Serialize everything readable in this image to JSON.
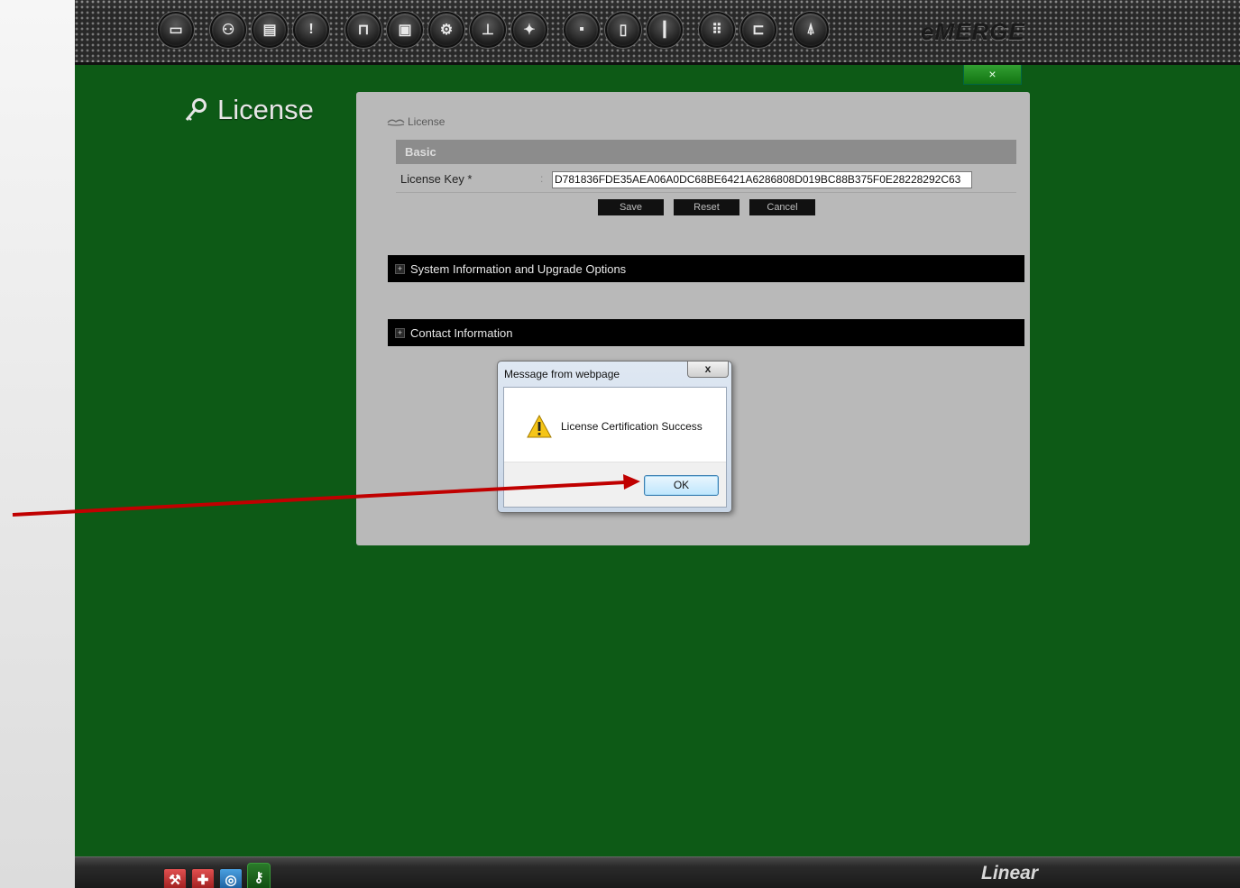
{
  "app": {
    "brand": "eMERGE",
    "close_tab_label": "×",
    "page_title": "License"
  },
  "toolbar": {
    "icons": [
      "monitor-icon",
      "user-icon",
      "id-card-icon",
      "alert-icon",
      "door-settings-icon",
      "photo-settings-icon",
      "gears-icon",
      "network-settings-icon",
      "puzzle-settings-icon",
      "save-icon",
      "document-icon",
      "report-icon",
      "keypad-icon",
      "door-icon",
      "exit-icon"
    ]
  },
  "panel": {
    "breadcrumb": "License",
    "section_title": "Basic",
    "license_key_label": "License Key *",
    "license_key_colon": ":",
    "license_key_value": "D781836FDE35AEA06A0DC68BE6421A6286808D019BC88B375F0E28228292C63",
    "save_label": "Save",
    "reset_label": "Reset",
    "cancel_label": "Cancel",
    "accordion_system": "System Information and Upgrade Options",
    "accordion_contact": "Contact Information",
    "accordion_toggle": "+"
  },
  "dialog": {
    "title": "Message from webpage",
    "close_label": "x",
    "message": "License Certification Success",
    "ok_label": "OK"
  },
  "footer": {
    "logo": "Linear",
    "icons": [
      "tools-icon",
      "medic-icon",
      "compass-icon",
      "key-icon"
    ]
  },
  "colors": {
    "app_background": "#0d5a16",
    "annotation_arrow": "#c00000",
    "panel_background": "#b9b9b9"
  }
}
